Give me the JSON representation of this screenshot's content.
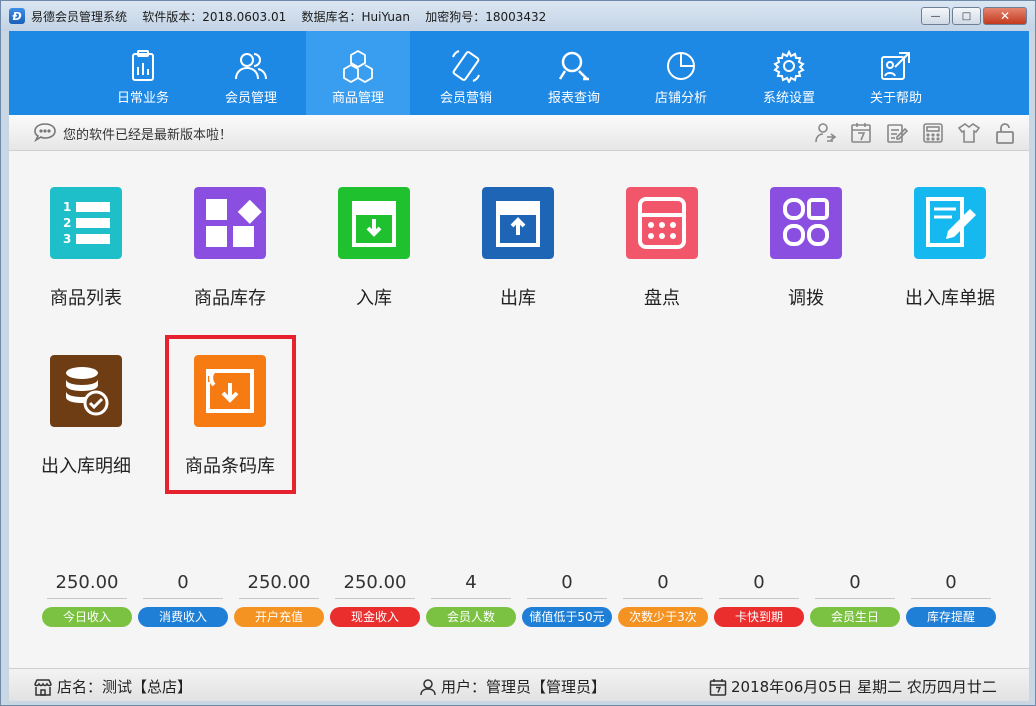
{
  "window": {
    "title": "易德会员管理系统    软件版本：2018.0603.01    数据库名：HuiYuan    加密狗号：18003432",
    "logo_letter": "Đ",
    "minimize": "—",
    "maximize": "□",
    "close": "✕"
  },
  "nav": {
    "items": [
      {
        "label": "日常业务",
        "icon": "clipboard-chart-icon"
      },
      {
        "label": "会员管理",
        "icon": "users-icon"
      },
      {
        "label": "商品管理",
        "icon": "cubes-icon",
        "active": true
      },
      {
        "label": "会员营销",
        "icon": "phone-icon"
      },
      {
        "label": "报表查询",
        "icon": "search-report-icon"
      },
      {
        "label": "店铺分析",
        "icon": "pie-chart-icon"
      },
      {
        "label": "系统设置",
        "icon": "gear-icon"
      },
      {
        "label": "关于帮助",
        "icon": "help-card-icon"
      }
    ]
  },
  "notice": {
    "text": "您的软件已经是最新版本啦！",
    "tools": [
      "user-switch-icon",
      "calendar-icon",
      "edit-note-icon",
      "calculator-icon",
      "shirt-icon",
      "lock-icon"
    ]
  },
  "tiles": [
    {
      "label": "商品列表",
      "icon": "numbered-list-icon",
      "color": "#1ebfc9"
    },
    {
      "label": "商品库存",
      "icon": "apps-grid-icon",
      "color": "#8a4fe0"
    },
    {
      "label": "入库",
      "icon": "inbox-in-icon",
      "color": "#1fc12f"
    },
    {
      "label": "出库",
      "icon": "inbox-out-icon",
      "color": "#1f65b5"
    },
    {
      "label": "盘点",
      "icon": "calculator-icon",
      "color": "#f2566a"
    },
    {
      "label": "调拨",
      "icon": "four-circles-icon",
      "color": "#8a4fe0"
    },
    {
      "label": "出入库单据",
      "icon": "document-pen-icon",
      "color": "#15b9f0"
    },
    {
      "label": "出入库明细",
      "icon": "database-check-icon",
      "color": "#6e3d14"
    },
    {
      "label": "商品条码库",
      "icon": "barcode-box-icon",
      "color": "#f57b12"
    }
  ],
  "stats": [
    {
      "value": "250.00",
      "label": "今日收入",
      "color": "#7cc242"
    },
    {
      "value": "0",
      "label": "消费收入",
      "color": "#1f7fd6"
    },
    {
      "value": "250.00",
      "label": "开户充值",
      "color": "#f59322"
    },
    {
      "value": "250.00",
      "label": "现金收入",
      "color": "#ea2e2e"
    },
    {
      "value": "4",
      "label": "会员人数",
      "color": "#7cc242"
    },
    {
      "value": "0",
      "label": "储值低于50元",
      "color": "#1f7fd6"
    },
    {
      "value": "0",
      "label": "次数少于3次",
      "color": "#f59322"
    },
    {
      "value": "0",
      "label": "卡快到期",
      "color": "#ea2e2e"
    },
    {
      "value": "0",
      "label": "会员生日",
      "color": "#7cc242"
    },
    {
      "value": "0",
      "label": "库存提醒",
      "color": "#1f7fd6"
    }
  ],
  "status": {
    "store": "店名：测试【总店】",
    "user": "用户：管理员【管理员】",
    "date": "2018年06月05日  星期二  农历四月廿二"
  }
}
